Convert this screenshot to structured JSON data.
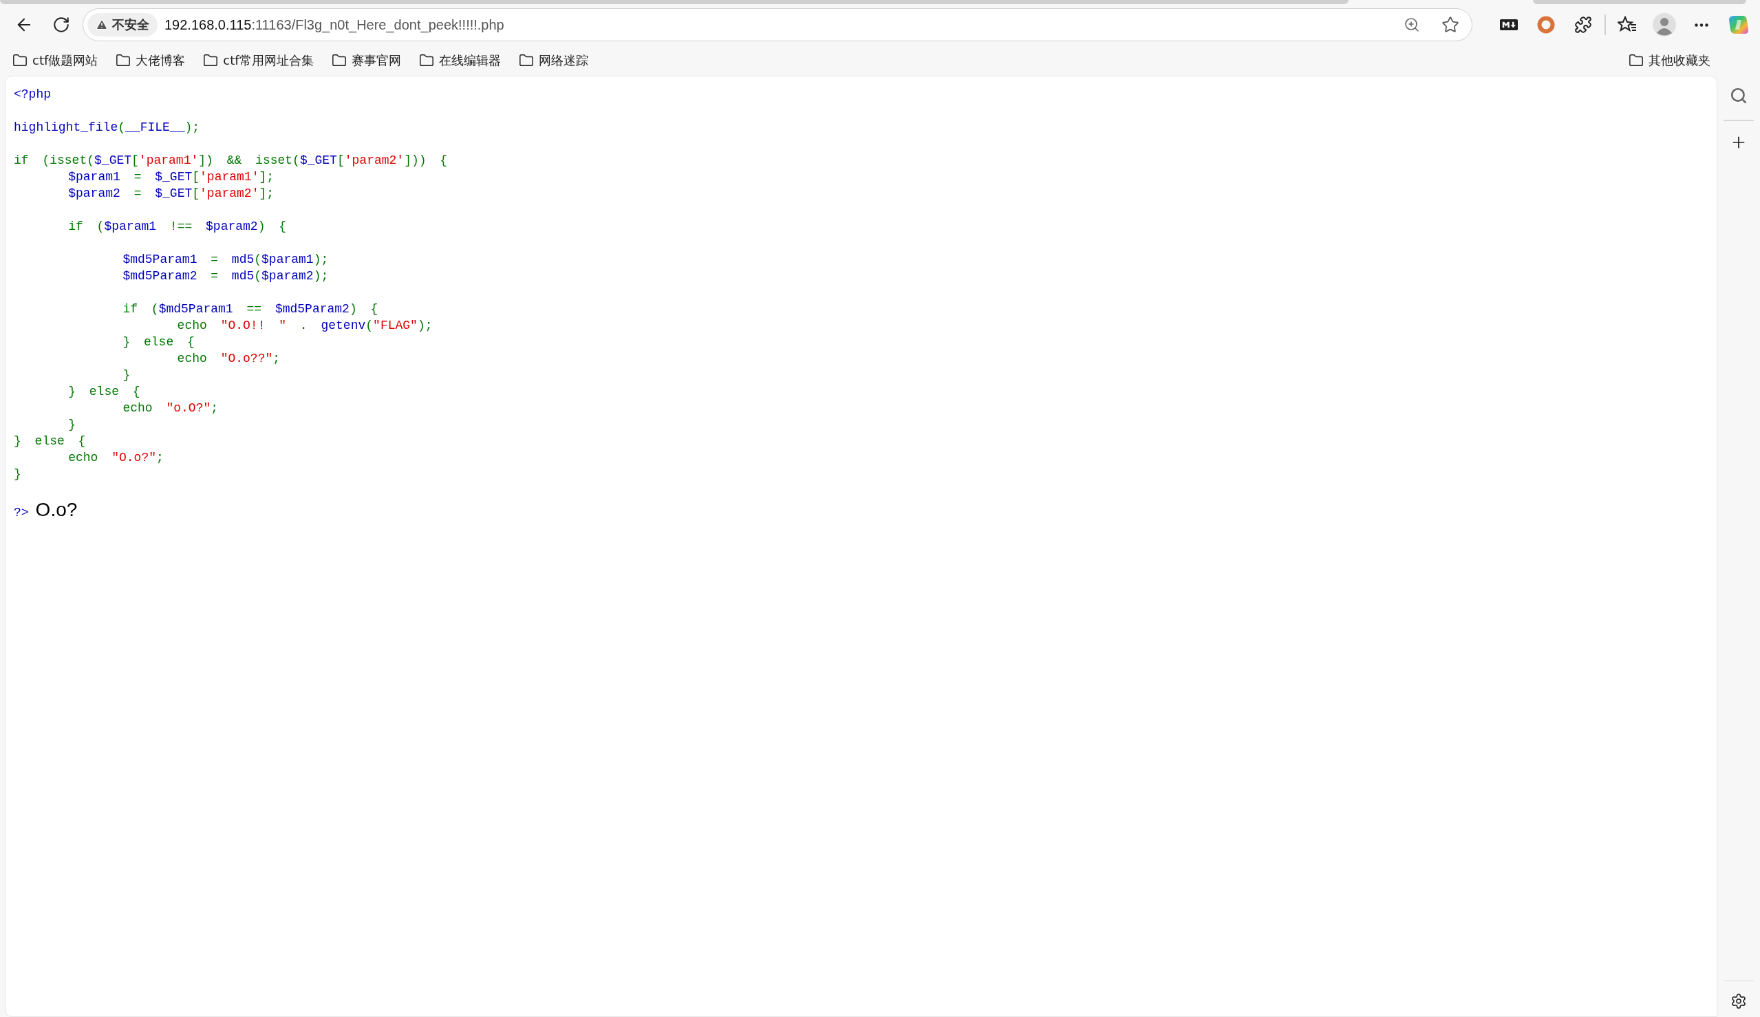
{
  "address_bar": {
    "security_label": "不安全",
    "host": "192.168.0.115",
    "path": ":11163/Fl3g_n0t_Here_dont_peek!!!!!.php"
  },
  "bookmarks": [
    {
      "label": "ctf做题网站"
    },
    {
      "label": "大佬博客"
    },
    {
      "label": "ctf常用网址合集"
    },
    {
      "label": "赛事官网"
    },
    {
      "label": "在线编辑器"
    },
    {
      "label": "网络迷踪"
    }
  ],
  "other_bookmarks": {
    "label": "其他收藏夹"
  },
  "source_code": {
    "blocks": [
      [
        [
          {
            "text": "<?php",
            "kind": "default"
          }
        ]
      ],
      [
        [
          {
            "text": "highlight_file",
            "kind": "default"
          },
          {
            "text": "(",
            "kind": "keyword"
          },
          {
            "text": "__FILE__",
            "kind": "default"
          },
          {
            "text": ");",
            "kind": "keyword"
          }
        ]
      ],
      [
        [
          {
            "text": "if (isset(",
            "kind": "keyword"
          },
          {
            "text": "$_GET",
            "kind": "default"
          },
          {
            "text": "[",
            "kind": "keyword"
          },
          {
            "text": "'param1'",
            "kind": "string"
          },
          {
            "text": "]) && isset(",
            "kind": "keyword"
          },
          {
            "text": "$_GET",
            "kind": "default"
          },
          {
            "text": "[",
            "kind": "keyword"
          },
          {
            "text": "'param2'",
            "kind": "string"
          },
          {
            "text": "])) {",
            "kind": "keyword"
          }
        ],
        [
          {
            "text": "    $param1",
            "kind": "default"
          },
          {
            "text": " = ",
            "kind": "keyword"
          },
          {
            "text": "$_GET",
            "kind": "default"
          },
          {
            "text": "[",
            "kind": "keyword"
          },
          {
            "text": "'param1'",
            "kind": "string"
          },
          {
            "text": "];",
            "kind": "keyword"
          }
        ],
        [
          {
            "text": "    $param2",
            "kind": "default"
          },
          {
            "text": " = ",
            "kind": "keyword"
          },
          {
            "text": "$_GET",
            "kind": "default"
          },
          {
            "text": "[",
            "kind": "keyword"
          },
          {
            "text": "'param2'",
            "kind": "string"
          },
          {
            "text": "];",
            "kind": "keyword"
          }
        ]
      ],
      [
        [
          {
            "text": "    if (",
            "kind": "keyword"
          },
          {
            "text": "$param1",
            "kind": "default"
          },
          {
            "text": " !== ",
            "kind": "keyword"
          },
          {
            "text": "$param2",
            "kind": "default"
          },
          {
            "text": ") {",
            "kind": "keyword"
          }
        ]
      ],
      [
        [
          {
            "text": "        $md5Param1",
            "kind": "default"
          },
          {
            "text": " = ",
            "kind": "keyword"
          },
          {
            "text": "md5",
            "kind": "default"
          },
          {
            "text": "(",
            "kind": "keyword"
          },
          {
            "text": "$param1",
            "kind": "default"
          },
          {
            "text": ");",
            "kind": "keyword"
          }
        ],
        [
          {
            "text": "        $md5Param2",
            "kind": "default"
          },
          {
            "text": " = ",
            "kind": "keyword"
          },
          {
            "text": "md5",
            "kind": "default"
          },
          {
            "text": "(",
            "kind": "keyword"
          },
          {
            "text": "$param2",
            "kind": "default"
          },
          {
            "text": ");",
            "kind": "keyword"
          }
        ]
      ],
      [
        [
          {
            "text": "        if (",
            "kind": "keyword"
          },
          {
            "text": "$md5Param1",
            "kind": "default"
          },
          {
            "text": " == ",
            "kind": "keyword"
          },
          {
            "text": "$md5Param2",
            "kind": "default"
          },
          {
            "text": ") {",
            "kind": "keyword"
          }
        ],
        [
          {
            "text": "            echo ",
            "kind": "keyword"
          },
          {
            "text": "\"O.O!! \"",
            "kind": "string"
          },
          {
            "text": " . ",
            "kind": "keyword"
          },
          {
            "text": "getenv",
            "kind": "default"
          },
          {
            "text": "(",
            "kind": "keyword"
          },
          {
            "text": "\"FLAG\"",
            "kind": "string"
          },
          {
            "text": ");",
            "kind": "keyword"
          }
        ],
        [
          {
            "text": "        } else {",
            "kind": "keyword"
          }
        ],
        [
          {
            "text": "            echo ",
            "kind": "keyword"
          },
          {
            "text": "\"O.o??\"",
            "kind": "string"
          },
          {
            "text": ";",
            "kind": "keyword"
          }
        ],
        [
          {
            "text": "        }",
            "kind": "keyword"
          }
        ],
        [
          {
            "text": "    } else {",
            "kind": "keyword"
          }
        ],
        [
          {
            "text": "        echo ",
            "kind": "keyword"
          },
          {
            "text": "\"o.O?\"",
            "kind": "string"
          },
          {
            "text": ";",
            "kind": "keyword"
          }
        ],
        [
          {
            "text": "    }",
            "kind": "keyword"
          }
        ],
        [
          {
            "text": "} else {",
            "kind": "keyword"
          }
        ],
        [
          {
            "text": "    echo ",
            "kind": "keyword"
          },
          {
            "text": "\"O.o?\"",
            "kind": "string"
          },
          {
            "text": ";",
            "kind": "keyword"
          }
        ],
        [
          {
            "text": "}",
            "kind": "keyword"
          }
        ]
      ]
    ],
    "closing_tag": "?>"
  },
  "output": "O.o?"
}
